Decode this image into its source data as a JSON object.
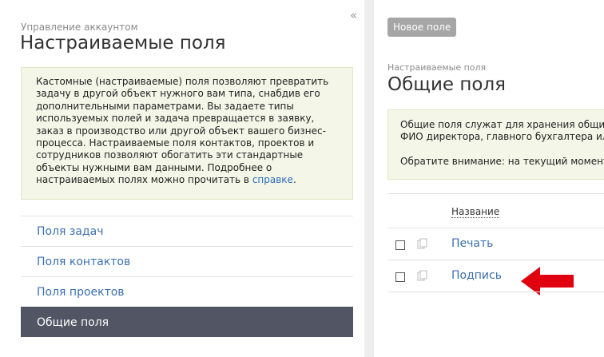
{
  "left": {
    "collapse_icon": "«",
    "breadcrumb": "Управление аккаунтом",
    "title": "Настраиваемые поля",
    "info_text_1": "Кастомные (настраиваемые) поля позволяют превратить задачу в другой объект нужного вам типа, снабдив его дополнительными параметрами. Вы задаете типы используемых полей и задача превращается в заявку, заказ в производство или другой объект вашего бизнес-процесса. Настраиваемые поля контактов, проектов и сотрудников позволяют обогатить эти стандартные объекты нужными вам данными. Подробнее о настраиваемых полях можно прочитать в ",
    "info_link": "справке",
    "info_text_2": ".",
    "nav": [
      {
        "label": "Поля задач"
      },
      {
        "label": "Поля контактов"
      },
      {
        "label": "Поля проектов"
      },
      {
        "label": "Общие поля"
      }
    ]
  },
  "right": {
    "new_field_label": "Новое поле",
    "breadcrumb": "Настраиваемые поля",
    "title": "Общие поля",
    "info_line_1": "Общие поля служат для хранения общих",
    "info_line_2": "ФИО директора, главного бухгалтера ил",
    "info_line_3": "Обратите внимание: на текущий момент",
    "table": {
      "column_name": "Название",
      "rows": [
        {
          "name": "Печать"
        },
        {
          "name": "Подпись"
        }
      ]
    }
  },
  "colors": {
    "accent_link": "#3a6fb0",
    "active_nav_bg": "#525563",
    "info_bg": "#f4f7e8",
    "arrow": "#e0000f"
  },
  "icons": {
    "copy": "copy-icon",
    "collapse": "double-chevron-left-icon",
    "pointer": "red-arrow-icon"
  }
}
